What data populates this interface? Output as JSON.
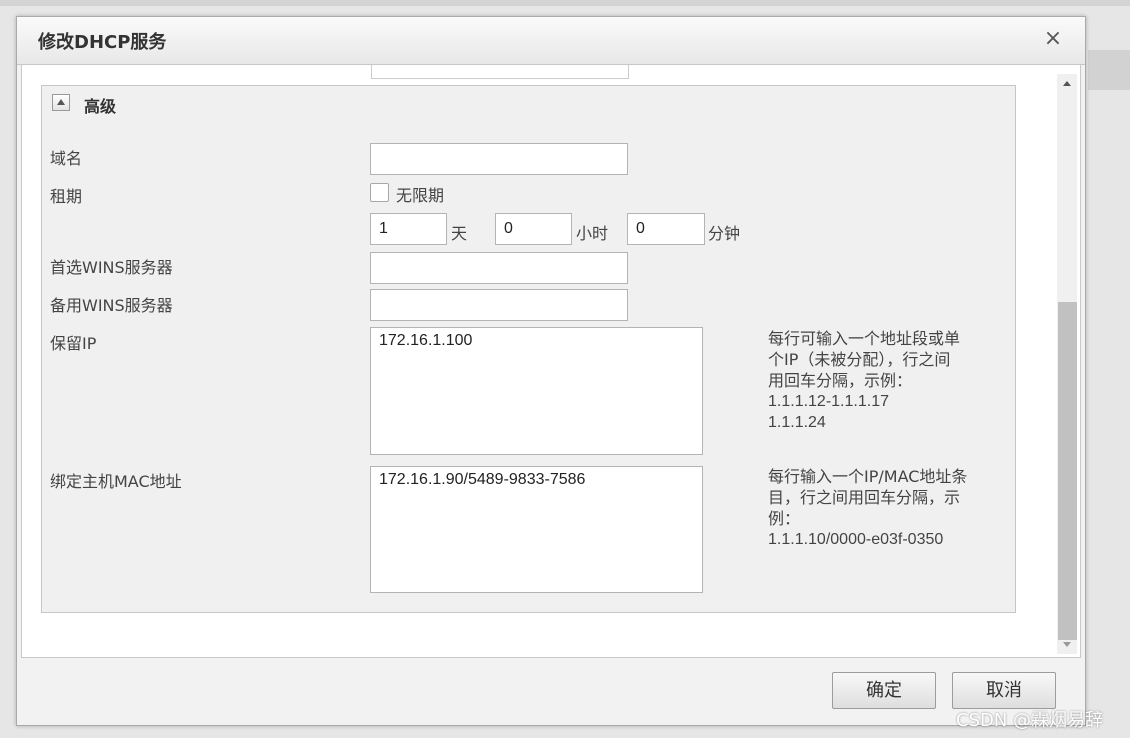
{
  "dialog": {
    "title": "修改DHCP服务",
    "close_label": "×"
  },
  "advanced": {
    "title": "高级",
    "domain_label": "域名",
    "domain_value": "",
    "lease_label": "租期",
    "unlimited_label": "无限期",
    "unlimited_checked": false,
    "lease_days": "1",
    "days_unit": "天",
    "lease_hours": "0",
    "hours_unit": "小时",
    "lease_minutes": "0",
    "minutes_unit": "分钟",
    "primary_wins_label": "首选WINS服务器",
    "primary_wins_value": "",
    "backup_wins_label": "备用WINS服务器",
    "backup_wins_value": "",
    "reserved_ip_label": "保留IP",
    "reserved_ip_value": "172.16.1.100",
    "reserved_ip_hint": [
      "每行可输入一个地址段或单",
      "个IP（未被分配），行之间",
      "用回车分隔，示例：",
      "1.1.1.12-1.1.1.17",
      "1.1.1.24"
    ],
    "bind_mac_label": "绑定主机MAC地址",
    "bind_mac_value": "172.16.1.90/5489-9833-7586",
    "bind_mac_hint": [
      "每行输入一个IP/MAC地址条",
      "目，行之间用回车分隔，示",
      "例：",
      "1.1.1.10/0000-e03f-0350"
    ]
  },
  "footer": {
    "ok_label": "确定",
    "cancel_label": "取消"
  },
  "watermark": "CSDN @霖烟易辞",
  "icons": {
    "collapse": "collapse-up-icon",
    "close": "close-icon",
    "scroll_up": "scroll-up-arrow-icon",
    "scroll_down": "scroll-down-arrow-icon"
  }
}
